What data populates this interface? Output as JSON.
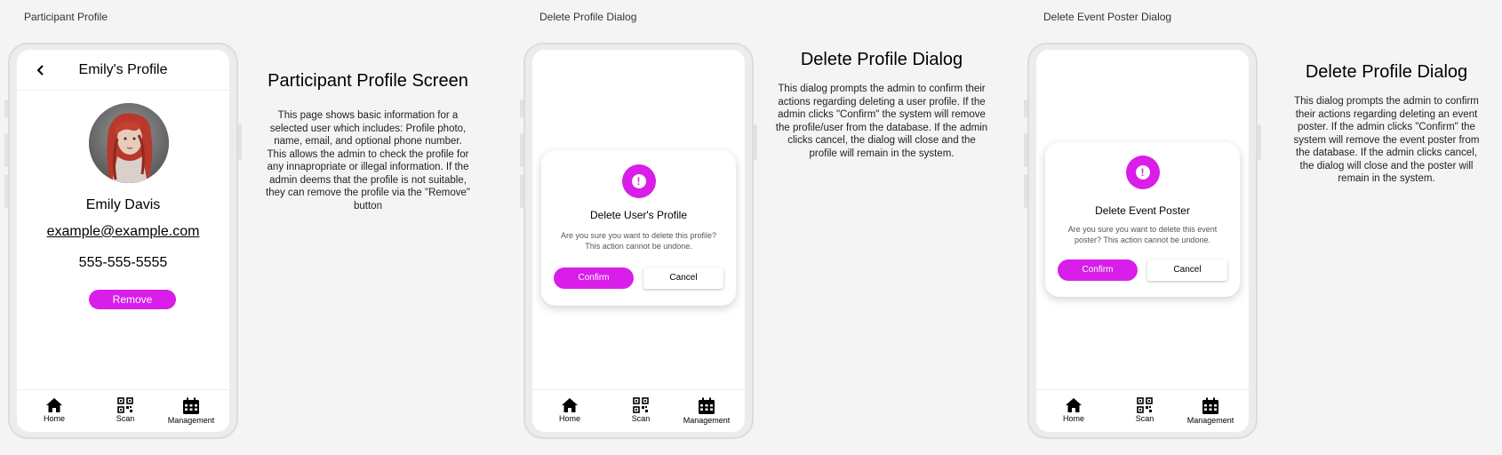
{
  "frames": {
    "profile_label": "Participant Profile",
    "delete_profile_label": "Delete Profile Dialog",
    "delete_poster_label": "Delete Event Poster Dialog"
  },
  "profile_screen": {
    "header_title": "Emily's Profile",
    "name": "Emily Davis",
    "email": "example@example.com",
    "phone": "555-555-5555",
    "remove_label": "Remove"
  },
  "nav": {
    "home": "Home",
    "scan": "Scan",
    "management": "Management"
  },
  "profile_desc": {
    "title": "Participant Profile Screen",
    "text": "This page shows basic information for a selected user which includes: Profile photo, name, email, and optional phone number. This allows the admin to check the profile for any innapropriate or illegal information. If the admin deems that the profile is not suitable, they can remove the profile via the \"Remove\" button"
  },
  "delete_profile_dialog": {
    "title": "Delete User's Profile",
    "message": "Are you sure you want to delete this profile? This action cannot be undone.",
    "confirm_label": "Confirm",
    "cancel_label": "Cancel"
  },
  "delete_profile_desc": {
    "title": "Delete Profile Dialog",
    "text": "This dialog prompts the admin to confirm their actions regarding deleting a user profile. If the admin clicks \"Confirm\" the system will remove the profile/user from the database. If the admin clicks cancel, the dialog will close and the profile will remain in the system."
  },
  "delete_poster_dialog": {
    "title": "Delete Event Poster",
    "message": "Are you sure you want to delete this event poster? This action cannot be undone.",
    "confirm_label": "Confirm",
    "cancel_label": "Cancel"
  },
  "delete_poster_desc": {
    "title": "Delete Profile Dialog",
    "text": "This dialog prompts the admin to confirm their actions regarding deleting an event poster. If the admin clicks \"Confirm\" the system will remove the event poster from the database. If the admin clicks cancel, the dialog will close and the poster will remain in the system."
  },
  "colors": {
    "accent": "#d81ee8",
    "background": "#f4f4f4"
  }
}
